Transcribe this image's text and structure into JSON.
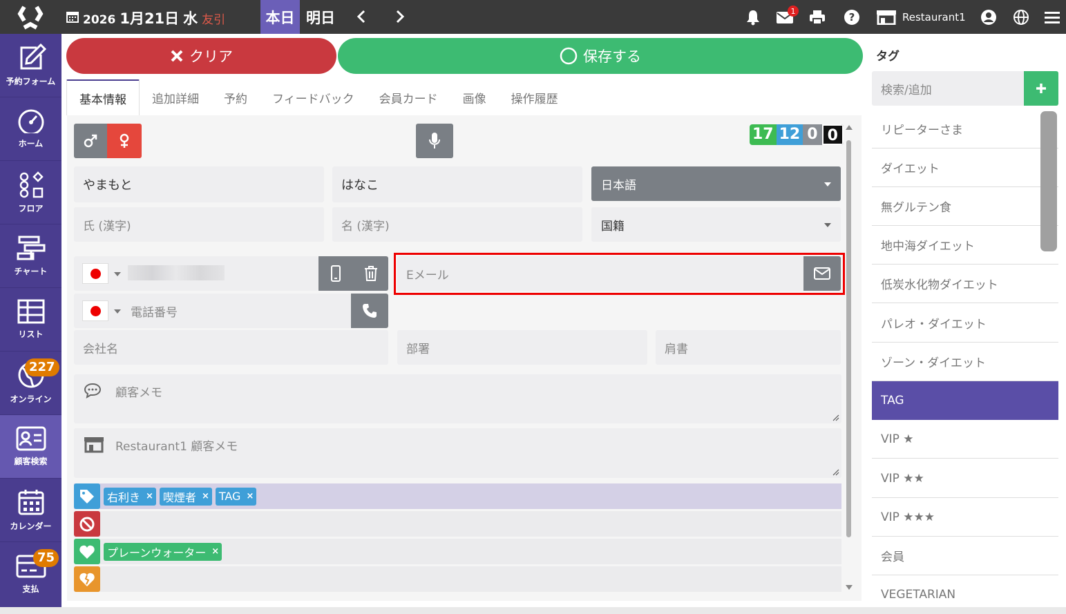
{
  "topbar": {
    "date_year": "2026",
    "date_main": "1月21日",
    "weekday": "水",
    "rokuyo": "友引",
    "today": "本日",
    "tomorrow": "明日",
    "mail_badge": "1",
    "restaurant": "Restaurant1"
  },
  "nav": [
    {
      "label": "予約フォーム",
      "icon": "edit-icon"
    },
    {
      "label": "ホーム",
      "icon": "gauge-icon"
    },
    {
      "label": "フロア",
      "icon": "floor-shapes-icon"
    },
    {
      "label": "チャート",
      "icon": "chart-icon"
    },
    {
      "label": "リスト",
      "icon": "list-table-icon"
    },
    {
      "label": "オンライン",
      "icon": "globe-icon",
      "badge": "227"
    },
    {
      "label": "顧客検索",
      "icon": "customer-card-icon"
    },
    {
      "label": "カレンダー",
      "icon": "calendar-icon"
    },
    {
      "label": "支払",
      "icon": "payment-card-icon",
      "badge": "75"
    }
  ],
  "actions": {
    "clear": "クリア",
    "save": "保存する"
  },
  "tabs": [
    "基本情報",
    "追加詳細",
    "予約",
    "フィードバック",
    "会員カード",
    "画像",
    "操作履歴"
  ],
  "counters": [
    "17",
    "12",
    "0",
    "0"
  ],
  "form": {
    "last_kana": "やまもと",
    "first_kana": "はなこ",
    "language": "日本語",
    "last_kanji_ph": "氏 (漢字)",
    "first_kanji_ph": "名 (漢字)",
    "nationality": "国籍",
    "email_ph": "Eメール",
    "phone_ph": "電話番号",
    "company_ph": "会社名",
    "department_ph": "部署",
    "title_ph": "肩書",
    "memo_ph": "顧客メモ",
    "store_memo_ph": "Restaurant1 顧客メモ"
  },
  "tag_rows": {
    "tags": [
      "右利き",
      "喫煙者",
      "TAG"
    ],
    "likes": [
      "プレーンウォーター"
    ]
  },
  "right": {
    "title": "タグ",
    "search_ph": "検索/追加",
    "items": [
      "リピーターさま",
      "ダイエット",
      "無グルテン食",
      "地中海ダイエット",
      "低炭水化物ダイエット",
      "パレオ・ダイエット",
      "ゾーン・ダイエット",
      "TAG",
      "VIP ★",
      "VIP ★★",
      "VIP ★★★",
      "会員",
      "VEGETARIAN"
    ],
    "selected": "TAG"
  },
  "colors": {
    "purple": "#4a3d8f",
    "red": "#c9393f",
    "green": "#3dbb72",
    "blue_chip": "#3f9fd8",
    "orange": "#e8952c",
    "gray_btn": "#7a7f85"
  }
}
